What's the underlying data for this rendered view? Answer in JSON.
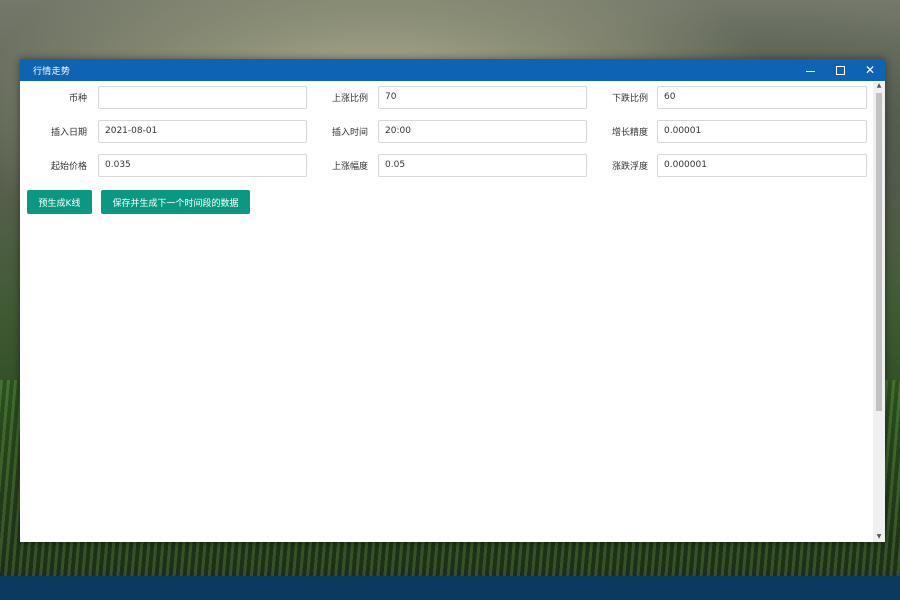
{
  "window": {
    "title": "行情走势",
    "controls": {
      "minimize_icon": "minimize-icon",
      "maximize_icon": "maximize-icon",
      "close_glyph": "✕"
    }
  },
  "form": {
    "row1": [
      {
        "label": "币种",
        "value": ""
      },
      {
        "label": "上涨比例",
        "value": "70"
      },
      {
        "label": "下跌比例",
        "value": "60"
      }
    ],
    "row2": [
      {
        "label": "插入日期",
        "value": "2021-08-01"
      },
      {
        "label": "插入时间",
        "value": "20:00"
      },
      {
        "label": "增长精度",
        "value": "0.00001"
      }
    ],
    "row3": [
      {
        "label": "起始价格",
        "value": "0.035"
      },
      {
        "label": "上涨幅度",
        "value": "0.05"
      },
      {
        "label": "涨跌浮度",
        "value": "0.000001"
      }
    ]
  },
  "buttons": {
    "pregen": "预生成K线",
    "save_next": "保存并生成下一个时间段的数据"
  },
  "scroll": {
    "up_glyph": "▲",
    "down_glyph": "▼"
  },
  "colors": {
    "titlebar": "#0e63b4",
    "button": "#0a9882",
    "taskbar": "#0b3a5e"
  }
}
